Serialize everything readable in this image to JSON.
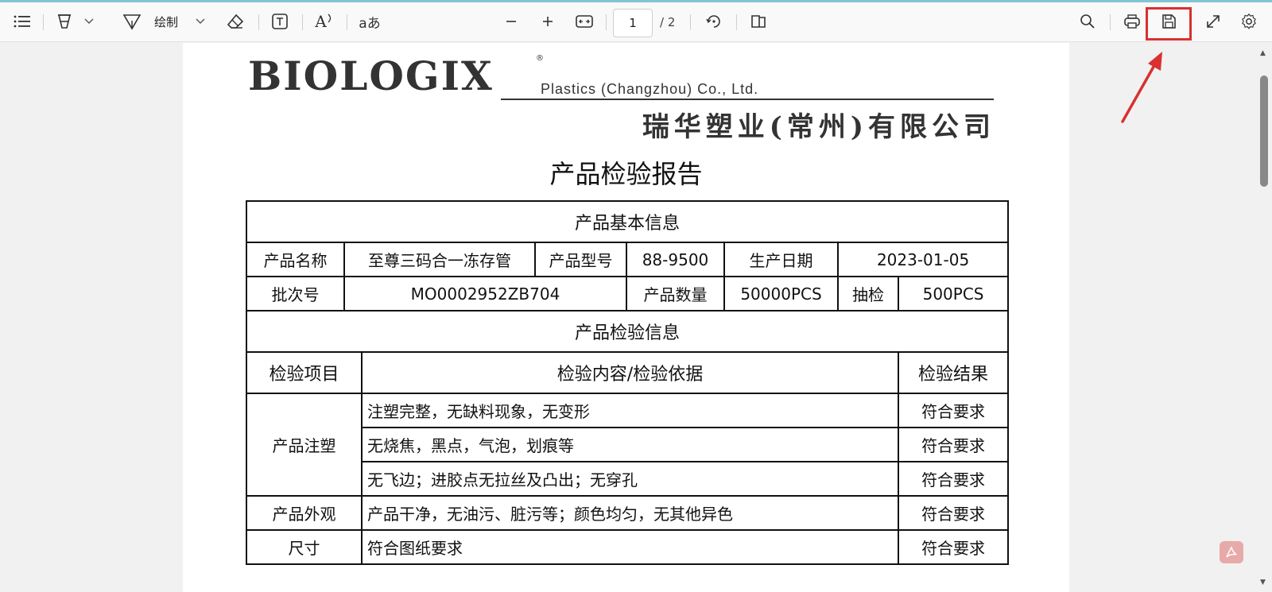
{
  "toolbar": {
    "draw_label": "绘制",
    "page_current": "1",
    "page_total": "/ 2",
    "icons": [
      "contents-icon",
      "highlight-icon",
      "draw-icon",
      "eraser-icon",
      "textbox-icon",
      "read-aloud-icon",
      "translate-icon",
      "zoom-out-icon",
      "zoom-in-icon",
      "fit-width-icon",
      "rotate-icon",
      "page-view-icon",
      "search-icon",
      "print-icon",
      "save-icon",
      "fullscreen-icon",
      "settings-icon"
    ],
    "translate_glyph": "aあ",
    "read_aloud_glyph": "A",
    "highlight_color": "#d93030"
  },
  "document": {
    "logo_brand": "BIOLOGIX",
    "logo_reg": "®",
    "logo_sub": "Plastics (Changzhou) Co., Ltd.",
    "logo_cn": "瑞华塑业(常州)有限公司",
    "title": "产品检验报告",
    "basic_info": {
      "header": "产品基本信息",
      "row1": [
        "产品名称",
        "至尊三码合一冻存管",
        "产品型号",
        "88-9500",
        "生产日期",
        "2023-01-05"
      ],
      "row2": [
        "批次号",
        "MO0002952ZB704",
        "产品数量",
        "50000PCS",
        "抽检",
        "500PCS"
      ]
    },
    "inspection": {
      "header": "产品检验信息",
      "columns": [
        "检验项目",
        "检验内容/检验依据",
        "检验结果"
      ],
      "rows": [
        {
          "item": "产品注塑",
          "content": "注塑完整，无缺料现象，无变形",
          "result": "符合要求"
        },
        {
          "item": "",
          "content": "无烧焦，黑点，气泡，划痕等",
          "result": "符合要求"
        },
        {
          "item": "",
          "content": "无飞边；进胶点无拉丝及凸出；无穿孔",
          "result": "符合要求"
        },
        {
          "item": "产品外观",
          "content": "产品干净，无油污、脏污等；颜色均匀，无其他异色",
          "result": "符合要求"
        },
        {
          "item": "尺寸",
          "content": "符合图纸要求",
          "result": "符合要求"
        }
      ]
    }
  }
}
